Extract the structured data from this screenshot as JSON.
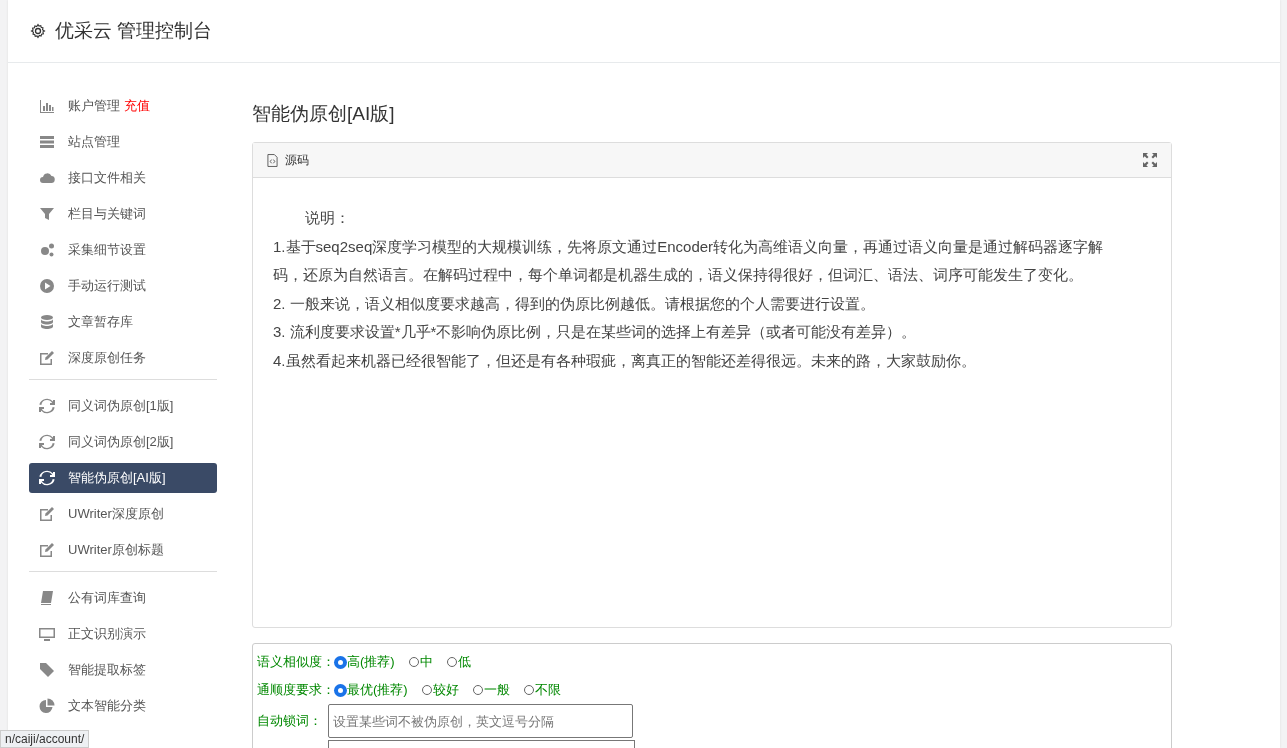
{
  "header": {
    "title": "优采云 管理控制台"
  },
  "sidebar": {
    "groups": [
      {
        "items": [
          {
            "label": "账户管理",
            "badge": "充值",
            "selected": false
          },
          {
            "label": "站点管理",
            "selected": false
          },
          {
            "label": "接口文件相关",
            "selected": false
          },
          {
            "label": "栏目与关键词",
            "selected": false
          },
          {
            "label": "采集细节设置",
            "selected": false
          },
          {
            "label": "手动运行测试",
            "selected": false
          },
          {
            "label": "文章暂存库",
            "selected": false
          },
          {
            "label": "深度原创任务",
            "selected": false
          }
        ]
      },
      {
        "items": [
          {
            "label": "同义词伪原创[1版]",
            "selected": false
          },
          {
            "label": "同义词伪原创[2版]",
            "selected": false
          },
          {
            "label": "智能伪原创[AI版]",
            "selected": true
          },
          {
            "label": "UWriter深度原创",
            "selected": false
          },
          {
            "label": "UWriter原创标题",
            "selected": false
          }
        ]
      },
      {
        "items": [
          {
            "label": "公有词库查询",
            "selected": false
          },
          {
            "label": "正文识别演示",
            "selected": false
          },
          {
            "label": "智能提取标签",
            "selected": false
          },
          {
            "label": "文本智能分类",
            "selected": false
          }
        ]
      }
    ]
  },
  "page_title": "智能伪原创[AI版]",
  "editor": {
    "tab": "源码",
    "heading": "说明：",
    "paragraphs": [
      "1.基于seq2seq深度学习模型的大规模训练，先将原文通过Encoder转化为高维语义向量，再通过语义向量是通过解码器逐字解码，还原为自然语言。在解码过程中，每个单词都是机器生成的，语义保持得很好，但词汇、语法、词序可能发生了变化。",
      "2. 一般来说，语义相似度要求越高，得到的伪原比例越低。请根据您的个人需要进行设置。",
      "3. 流利度要求设置*几乎*不影响伪原比例，只是在某些词的选择上有差异（或者可能没有差异）。",
      "4.虽然看起来机器已经很智能了，但还是有各种瑕疵，离真正的智能还差得很远。未来的路，大家鼓励你。"
    ]
  },
  "options": [
    {
      "label": "语义相似度：",
      "choices": [
        {
          "label": "高(推荐)",
          "selected": true
        },
        {
          "label": "中",
          "selected": false
        },
        {
          "label": "低",
          "selected": false
        }
      ]
    },
    {
      "label": "通顺度要求：",
      "choices": [
        {
          "label": "最优(推荐)",
          "selected": true
        },
        {
          "label": "较好",
          "selected": false
        },
        {
          "label": "一般",
          "selected": false
        },
        {
          "label": "不限",
          "selected": false
        }
      ]
    }
  ],
  "lock_words": {
    "label": "自动锁词：",
    "placeholder": "设置某些词不被伪原创，英文逗号分隔"
  },
  "status_url": "n/caiji/account/"
}
